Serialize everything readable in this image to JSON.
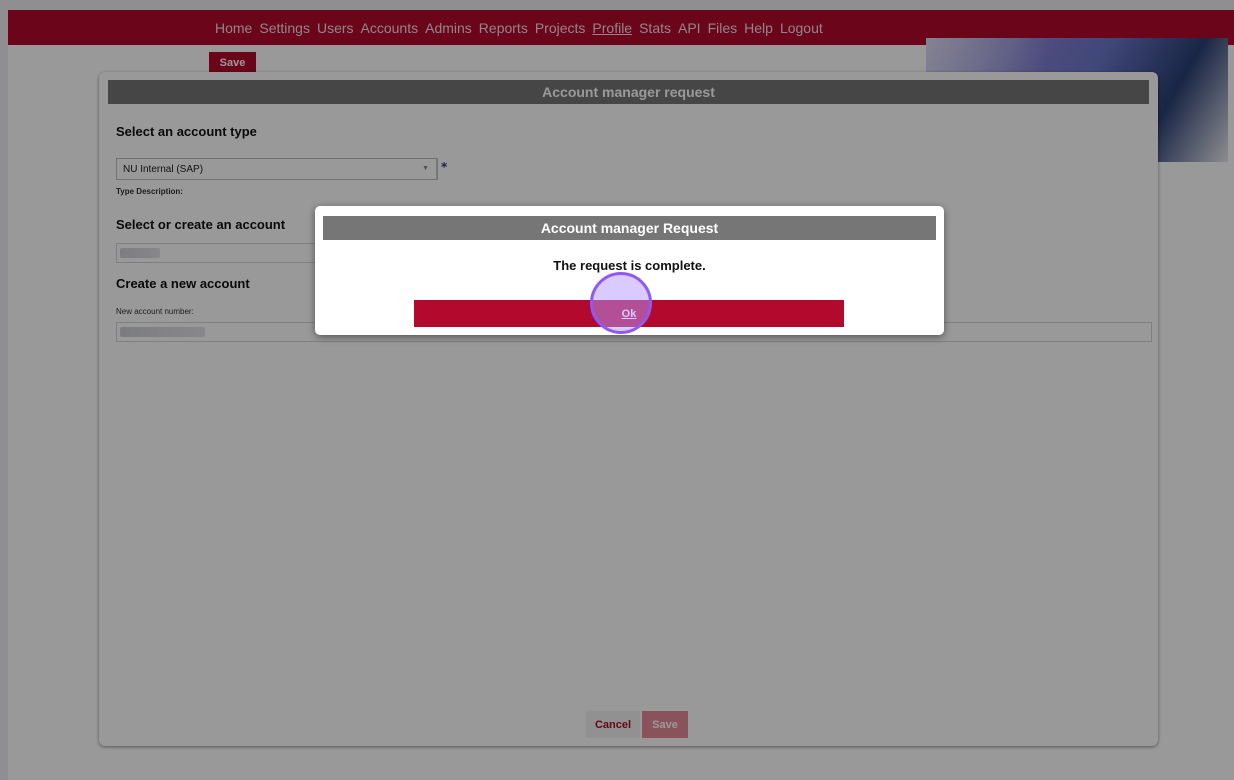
{
  "nav": {
    "items": [
      "Home",
      "Settings",
      "Users",
      "Accounts",
      "Admins",
      "Reports",
      "Projects",
      "Profile",
      "Stats",
      "API",
      "Files",
      "Help",
      "Logout"
    ],
    "active": "Profile"
  },
  "background_save_label": "Save",
  "modal": {
    "title": "Account manager request",
    "account_type_heading": "Select an account type",
    "account_type_value": "NU Internal (SAP)",
    "type_description_label": "Type Description:",
    "select_create_heading": "Select or create an account",
    "create_new_heading": "Create a new account",
    "new_account_number_label": "New account number:",
    "cancel_label": "Cancel",
    "save_label": "Save"
  },
  "dialog": {
    "title": "Account manager Request",
    "message": "The request is complete.",
    "ok_label": "Ok"
  },
  "colors": {
    "brand": "#b3092c",
    "header_gray": "#767676",
    "click_indicator": "#9158f2"
  }
}
